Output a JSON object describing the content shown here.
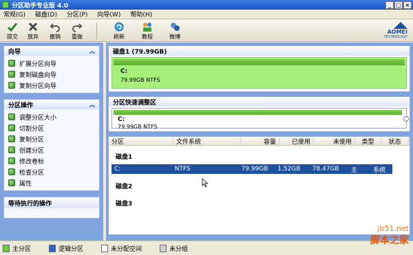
{
  "window": {
    "title": "分区助手专业版 4.0",
    "controls": [
      "_",
      "□",
      "×"
    ]
  },
  "menu": [
    "常规(G)",
    "磁盘(D)",
    "分区(P)",
    "向导(W)",
    "帮助(H)"
  ],
  "toolbar": {
    "buttons": [
      {
        "label": "提交",
        "icon": "submit-icon"
      },
      {
        "label": "放弃",
        "icon": "discard-icon"
      },
      {
        "label": "撤销",
        "icon": "undo-icon"
      },
      {
        "label": "重做",
        "icon": "redo-icon"
      },
      {
        "label": "刷新",
        "icon": "refresh-icon"
      },
      {
        "label": "教程",
        "icon": "tutorial-icon"
      },
      {
        "label": "微博",
        "icon": "weibo-icon"
      }
    ],
    "logo": {
      "brand": "AOMEI",
      "sub": "TECHNOLOGY"
    }
  },
  "sidebar": {
    "wizard": {
      "title": "向导",
      "items": [
        "扩展分区向导",
        "复制磁盘向导",
        "复制分区向导"
      ]
    },
    "ops": {
      "title": "分区操作",
      "items": [
        "调整分区大小",
        "切割分区",
        "复制分区",
        "创建分区",
        "修改卷标",
        "检查分区",
        "属性"
      ]
    },
    "pending": {
      "title": "等待执行的操作"
    }
  },
  "disk_panel": {
    "title": "磁盘1  (79.99GB)",
    "partition_label": "C:",
    "partition_info": "79.99GB NTFS"
  },
  "resize_panel": {
    "title": "分区快速调整区",
    "partition_label": "C:",
    "partition_info": "79.99GB NTFS"
  },
  "table": {
    "headers": [
      "分区",
      "文件系统",
      "容量",
      "已使用",
      "未使用",
      "类型",
      "状态"
    ],
    "disks": [
      {
        "name": "磁盘1",
        "rows": [
          {
            "part": "C:",
            "fs": "NTFS",
            "capacity": "79.99GB",
            "used": "1.52GB",
            "unused": "78.47GB",
            "type": "主",
            "status": "系统"
          }
        ]
      },
      {
        "name": "磁盘2",
        "rows": []
      },
      {
        "name": "磁盘3",
        "rows": []
      }
    ]
  },
  "legend": [
    {
      "label": "主分区",
      "color": "#6dcc3e"
    },
    {
      "label": "逻辑分区",
      "color": "#2f63c4"
    },
    {
      "label": "未分配空间",
      "color": "#ffffff"
    },
    {
      "label": "未分组",
      "color": "#d0d0d0"
    }
  ],
  "watermark": {
    "site": "jb51.net",
    "name": "脚本之家"
  }
}
